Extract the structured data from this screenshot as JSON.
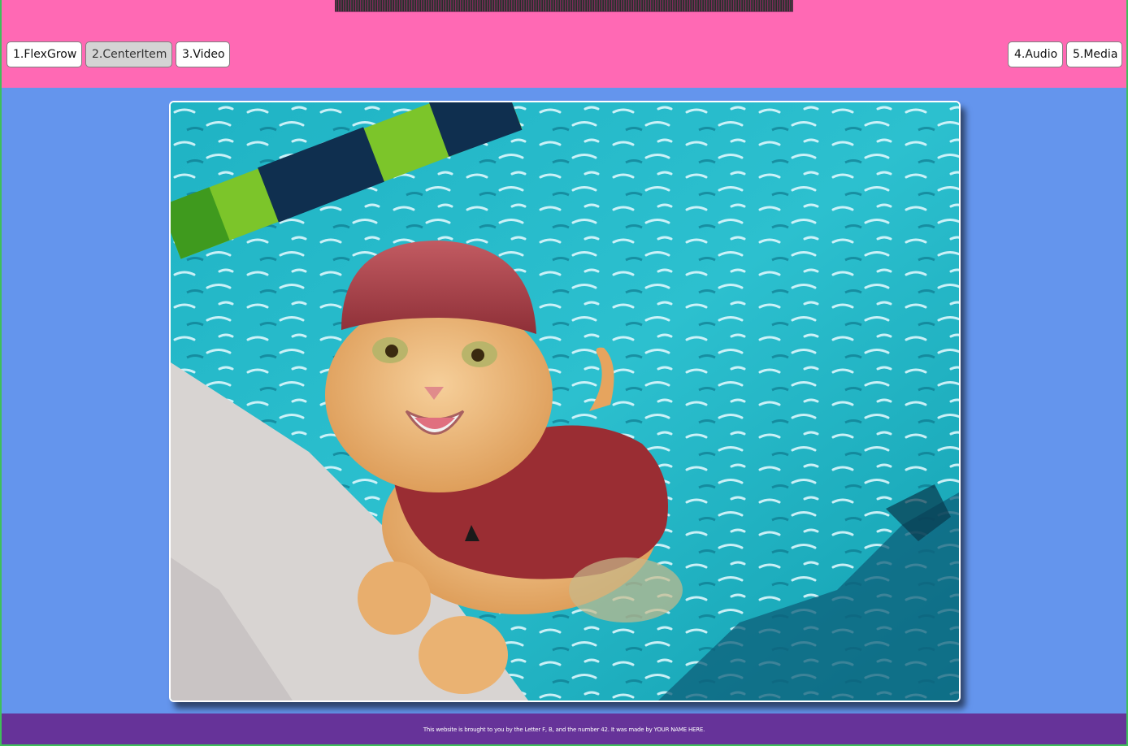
{
  "nav": {
    "items": [
      {
        "label": "1.FlexGrow",
        "active": false
      },
      {
        "label": "2.CenterItem",
        "active": true
      },
      {
        "label": "3.Video",
        "active": false
      },
      {
        "label": "4.Audio",
        "active": false
      },
      {
        "label": "5.Media",
        "active": false
      }
    ]
  },
  "main": {
    "image_subject": "kitten-in-swimsuit-at-pool"
  },
  "footer": {
    "text": "This website is brought to you by the Letter F, B, and the number 42. It was made by YOUR NAME HERE."
  },
  "colors": {
    "header_bg": "#ff69b4",
    "main_bg": "#6495ed",
    "footer_bg": "#663399",
    "page_border": "#3fbf5a",
    "active_button_bg": "#d4d4d4"
  }
}
